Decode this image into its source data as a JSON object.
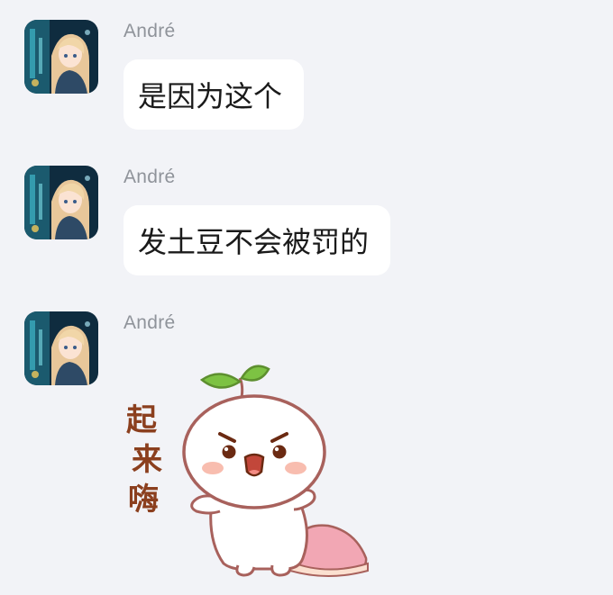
{
  "messages": [
    {
      "sender": "André",
      "text": "是因为这个"
    },
    {
      "sender": "André",
      "text": "发土豆不会被罚的"
    },
    {
      "sender": "André",
      "sticker": {
        "icon": "sprout-bun-sticker",
        "caption": [
          "起",
          "来",
          "嗨"
        ]
      }
    }
  ],
  "colors": {
    "background": "#f2f3f7",
    "bubble": "#ffffff",
    "sender_name": "#8f939a",
    "sticker_caption": "#8b3f1e",
    "leaf": "#7dc243",
    "pillow": "#f2a7b4"
  }
}
